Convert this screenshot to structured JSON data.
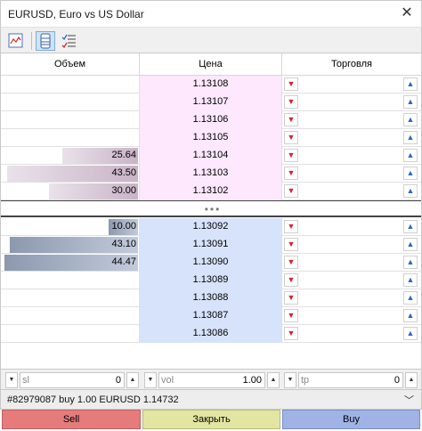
{
  "window": {
    "title": "EURUSD, Euro vs US Dollar",
    "close_glyph": "✕"
  },
  "toolbar": {
    "buttons": [
      {
        "icon": "chart-icon"
      },
      {
        "icon": "depth-icon",
        "active": true
      },
      {
        "icon": "trade-list-icon"
      }
    ]
  },
  "table": {
    "headers": {
      "volume": "Объем",
      "price": "Цена",
      "trade": "Торговля"
    },
    "ask_rows": [
      {
        "volume": "",
        "price": "1.13108",
        "fill": 0
      },
      {
        "volume": "",
        "price": "1.13107",
        "fill": 0
      },
      {
        "volume": "",
        "price": "1.13106",
        "fill": 0
      },
      {
        "volume": "",
        "price": "1.13105",
        "fill": 0
      },
      {
        "volume": "25.64",
        "price": "1.13104",
        "fill": 0.56
      },
      {
        "volume": "43.50",
        "price": "1.13103",
        "fill": 0.97
      },
      {
        "volume": "30.00",
        "price": "1.13102",
        "fill": 0.66
      }
    ],
    "separator": "•••",
    "bid_rows": [
      {
        "volume": "10.00",
        "price": "1.13092",
        "fill": 0.22
      },
      {
        "volume": "43.10",
        "price": "1.13091",
        "fill": 0.95
      },
      {
        "volume": "44.47",
        "price": "1.13090",
        "fill": 0.99
      },
      {
        "volume": "",
        "price": "1.13089",
        "fill": 0
      },
      {
        "volume": "",
        "price": "1.13088",
        "fill": 0
      },
      {
        "volume": "",
        "price": "1.13087",
        "fill": 0
      },
      {
        "volume": "",
        "price": "1.13086",
        "fill": 0
      }
    ]
  },
  "controls": {
    "sl": {
      "placeholder": "sl",
      "value": "0"
    },
    "vol": {
      "placeholder": "vol",
      "value": "1.00"
    },
    "tp": {
      "placeholder": "tp",
      "value": "0"
    }
  },
  "position": {
    "text": "#82979087 buy 1.00 EURUSD 1.14732"
  },
  "actions": {
    "sell": "Sell",
    "close": "Закрыть",
    "buy": "Buy"
  },
  "colors": {
    "ask_price_bg": "#fde8fd",
    "bid_price_bg": "#d7e3fb",
    "sell_button": "#e57b7b",
    "close_button": "#e3e6a1",
    "buy_button": "#9fb3e6"
  }
}
